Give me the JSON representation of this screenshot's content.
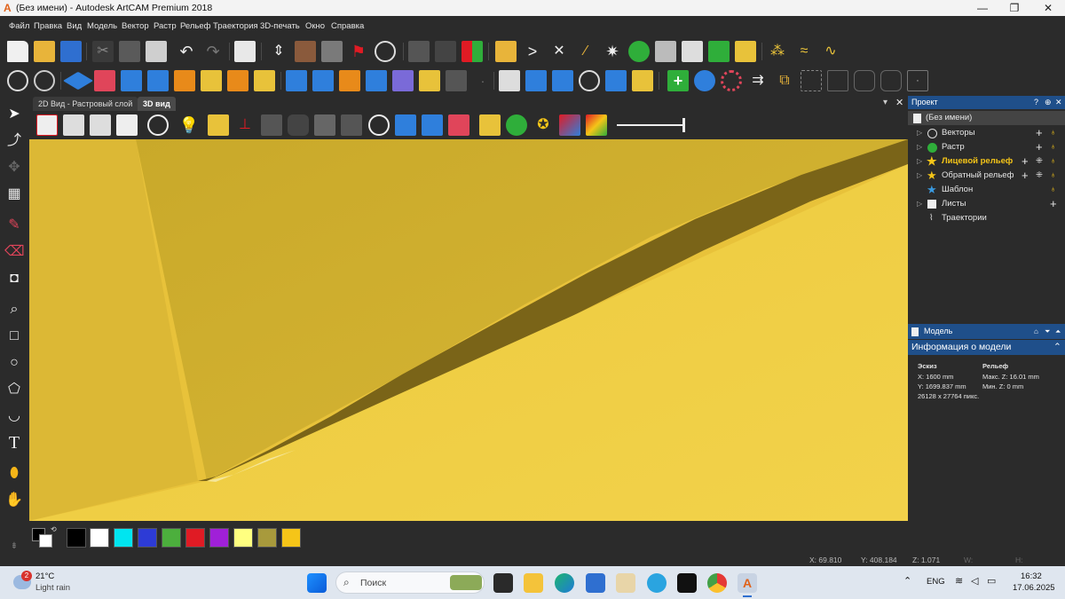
{
  "window": {
    "title": "(Без имени) - Autodesk ArtCAM Premium 2018",
    "logo": "A",
    "controls": [
      "—",
      "❐",
      "✕"
    ]
  },
  "menu": [
    "Файл",
    "Правка",
    "Вид",
    "Модель",
    "Вектор",
    "Растр",
    "Рельеф",
    "Траектория",
    "3D-печать",
    "Окно",
    "Справка"
  ],
  "tabs": {
    "raster": "2D Вид - Растровый слой",
    "view3d": "3D вид",
    "pin_icon": "pin-icon",
    "close_icon": "close-icon"
  },
  "project_panel": {
    "title": "Проект",
    "header_icons": [
      "?",
      "⊕",
      "✕"
    ],
    "root": "(Без имени)",
    "items": [
      {
        "label": "Векторы",
        "bold": false
      },
      {
        "label": "Растр",
        "bold": false
      },
      {
        "label": "Лицевой рельеф",
        "bold": true
      },
      {
        "label": "Обратный рельеф",
        "bold": false
      },
      {
        "label": "Шаблон",
        "bold": false
      },
      {
        "label": "Листы",
        "bold": false
      },
      {
        "label": "Траектории",
        "bold": false
      }
    ]
  },
  "model_panel": {
    "title": "Модель",
    "info_title": "Информация о модели",
    "sketch": {
      "heading": "Эскиз",
      "x": "X: 1600 mm",
      "y": "Y: 1699.837 mm",
      "pixels": "26128 x 27764 пикс."
    },
    "relief": {
      "heading": "Рельеф",
      "max_z": "Макс. Z: 16.01 mm",
      "min_z": "Мин. Z: 0 mm"
    }
  },
  "status": {
    "x": "X: 69.810",
    "y": "Y: 408.184",
    "z": "Z: 1.071",
    "w": "W:",
    "h": "H:"
  },
  "palette": {
    "colors": [
      "#000000",
      "#ffffff",
      "#00e5f0",
      "#2d3bd6",
      "#4caf3d",
      "#e01b24",
      "#a020d8",
      "#ffff80",
      "#a89a3c",
      "#f5c518"
    ]
  },
  "taskbar": {
    "weather_temp": "21°C",
    "weather_desc": "Light rain",
    "weather_badge": "2",
    "search_placeholder": "Поиск",
    "lang": "ENG",
    "time": "16:32",
    "date": "17.06.2025"
  },
  "accent_colors": {
    "relief": "#e8c23a",
    "panel_header": "#1f4f8a"
  }
}
